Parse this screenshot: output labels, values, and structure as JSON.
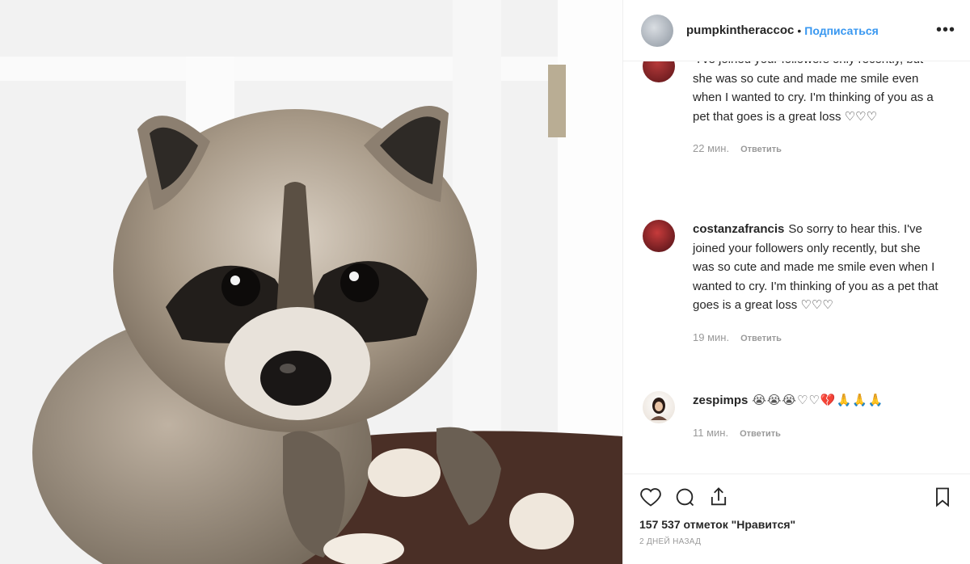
{
  "header": {
    "username": "pumpkintheraccoc",
    "separator": "•",
    "follow_label": "Подписаться",
    "more_label": "•••"
  },
  "comments": [
    {
      "username": "",
      "text": "I've joined your followers only recently, but she was so cute and made me smile even when I wanted to cry. I'm thinking of you as a pet that goes is a great loss ♡♡♡",
      "time": "22 мин.",
      "reply_label": "Ответить",
      "avatar_color": "#7a1d22"
    },
    {
      "username": "costanzafrancis",
      "text": "So sorry to hear this. I've joined your followers only recently, but she was so cute and made me smile even when I wanted to cry. I'm thinking of you as a pet that goes is a great loss ♡♡♡",
      "time": "19 мин.",
      "reply_label": "Ответить",
      "avatar_color": "#8a1c22"
    },
    {
      "username": "zespimps",
      "text": "😭😭😭♡♡💔🙏🙏🙏",
      "time": "11 мин.",
      "reply_label": "Ответить",
      "avatar_color": "#f1ece6"
    }
  ],
  "actions": {
    "likes_text": "157 537 отметок \"Нравится\"",
    "date_text": "2 ДНЕЙ НАЗАД"
  },
  "icons": [
    "heart-icon",
    "comment-icon",
    "share-icon",
    "bookmark-icon"
  ],
  "colors": {
    "link": "#3897f0",
    "muted": "#999999",
    "text": "#262626"
  }
}
